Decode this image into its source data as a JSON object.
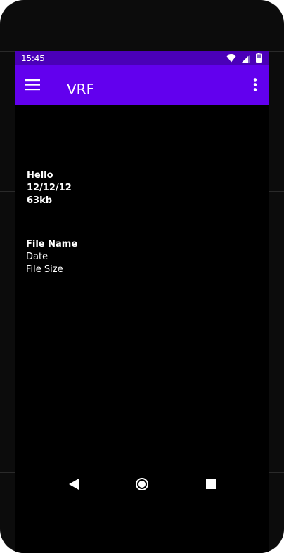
{
  "status_bar": {
    "time": "15:45",
    "icons": [
      "wifi-icon",
      "signal-icon",
      "battery-icon"
    ]
  },
  "toolbar": {
    "title": "VRF",
    "menu_icon": "hamburger-menu-icon",
    "overflow_icon": "more-vert-icon"
  },
  "file_items": [
    {
      "name": "Hello",
      "date": "12/12/12",
      "size": "63kb"
    },
    {
      "name": "File Name",
      "date": "Date",
      "size": "File Size"
    }
  ],
  "nav_bar": {
    "icons": [
      "back-icon",
      "home-icon",
      "recents-icon"
    ]
  },
  "colors": {
    "status_bar": "#4a00b8",
    "toolbar": "#6200ee",
    "background": "#000000",
    "text": "#ffffff"
  }
}
